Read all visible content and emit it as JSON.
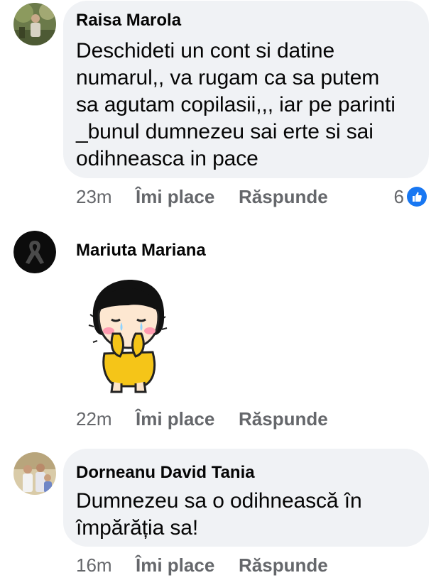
{
  "comments": [
    {
      "author": "Raisa Marola",
      "lines": [
        "Deschideti un cont si datine",
        "numarul,, va rugam ca sa putem",
        "sa agutam copilasii,,, iar pe parinti",
        "_bunul dumnezeu sai erte si sai",
        "odihneasca in pace"
      ],
      "time": "23m",
      "like_label": "Îmi place",
      "reply_label": "Răspunde",
      "reaction_count": "6",
      "reaction_icon": "like-icon",
      "avatar_icon": "profile-photo-outdoor"
    },
    {
      "author": "Mariuta Mariana",
      "sticker_icon": "crying-girl-sticker",
      "time": "22m",
      "like_label": "Îmi place",
      "reply_label": "Răspunde",
      "avatar_icon": "black-mourning-ribbon-icon"
    },
    {
      "author": "Dorneanu David Tania",
      "lines": [
        "Dumnezeu sa o odihnească în",
        "împărăția sa!"
      ],
      "time": "16m",
      "like_label": "Îmi place",
      "reply_label": "Răspunde",
      "avatar_icon": "profile-photo-group"
    }
  ],
  "colors": {
    "bubble_bg": "#f0f2f5",
    "meta_text": "#65676b",
    "like_blue": "#1877f2",
    "sticker_yellow": "#f5c518",
    "sticker_blush": "#ff9bb0"
  }
}
